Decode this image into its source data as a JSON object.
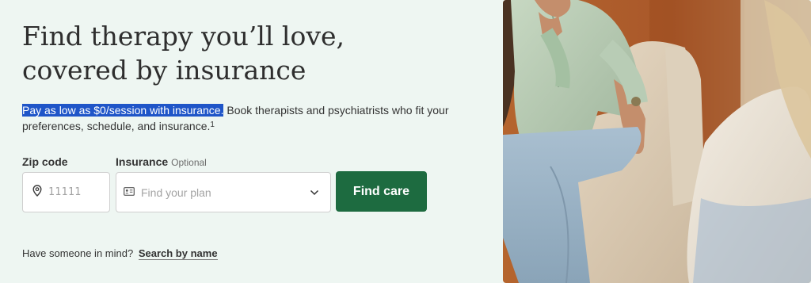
{
  "hero": {
    "title_line1": "Find therapy you’ll love,",
    "title_line2": "covered by insurance",
    "subtitle_highlight": "Pay as low as $0/session with insurance.",
    "subtitle_rest": " Book therapists and psychiatrists who fit your preferences, schedule, and insurance.",
    "footnote": "1"
  },
  "form": {
    "zip_label": "Zip code",
    "zip_placeholder": "11111",
    "zip_icon": "location-pin-icon",
    "insurance_label": "Insurance",
    "insurance_optional": "Optional",
    "insurance_placeholder": "Find your plan",
    "insurance_icon": "id-card-icon",
    "insurance_dropdown_icon": "chevron-down-icon",
    "submit_label": "Find care"
  },
  "footer": {
    "prompt": "Have someone in mind?",
    "link": "Search by name"
  },
  "colors": {
    "background": "#eef6f2",
    "primary_button": "#1d6b40",
    "selection_highlight": "#1f55c8"
  }
}
